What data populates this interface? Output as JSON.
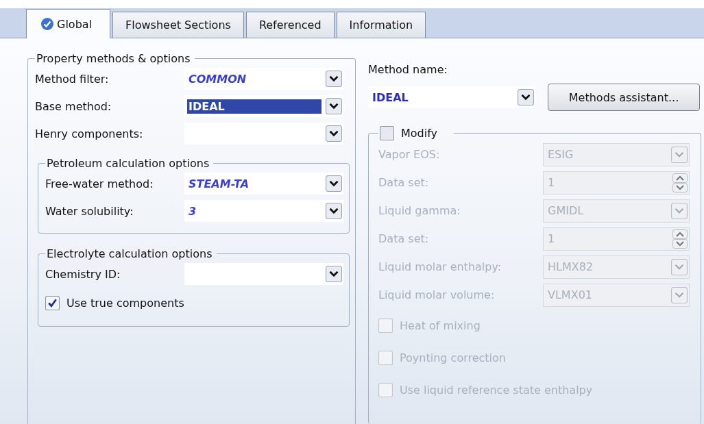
{
  "tabs": [
    {
      "label": "Global",
      "selected": true,
      "kind": "verified"
    },
    {
      "label": "Flowsheet Sections",
      "selected": false
    },
    {
      "label": "Referenced",
      "selected": false
    },
    {
      "label": "Information",
      "selected": false
    }
  ],
  "property_methods": {
    "title": "Property methods & options",
    "fields": [
      {
        "label": "Method filter:",
        "value": "COMMON",
        "kind": "default"
      },
      {
        "label": "Base method:",
        "value": "IDEAL",
        "kind": "selected"
      },
      {
        "label": "Henry components:"
      }
    ]
  },
  "petroleum": {
    "title": "Petroleum calculation options",
    "fields": [
      {
        "label": "Free-water method:",
        "value": "STEAM-TA",
        "kind": "default"
      },
      {
        "label": "Water solubility:",
        "value": "3",
        "kind": "default"
      }
    ]
  },
  "electrolyte": {
    "title": "Electrolyte calculation options",
    "fields": [
      {
        "label": "Chemistry ID:"
      }
    ],
    "checkbox": {
      "label": "Use true components",
      "checked": true
    }
  },
  "method_name": {
    "label": "Method name:",
    "value": "IDEAL"
  },
  "assistant_button": "Methods assistant...",
  "modify": {
    "label": "Modify",
    "checked": false,
    "disabled": true,
    "fields": [
      {
        "label": "Vapor EOS:",
        "value": "ESIG",
        "kind": "dropdown"
      },
      {
        "label": "Data set:",
        "value": "1",
        "kind": "spinner"
      },
      {
        "label": "Liquid gamma:",
        "value": "GMIDL",
        "kind": "dropdown"
      },
      {
        "label": "Data set:",
        "value": "1",
        "kind": "spinner"
      },
      {
        "label": "Liquid molar enthalpy:",
        "value": "HLMX82",
        "kind": "dropdown"
      },
      {
        "label": "Liquid molar volume:",
        "value": "VLMX01",
        "kind": "dropdown"
      }
    ],
    "checkboxes": [
      {
        "label": "Heat of mixing",
        "checked": false
      },
      {
        "label": "Poynting correction",
        "checked": false
      },
      {
        "label": "Use liquid reference state enthalpy",
        "checked": false
      }
    ]
  }
}
